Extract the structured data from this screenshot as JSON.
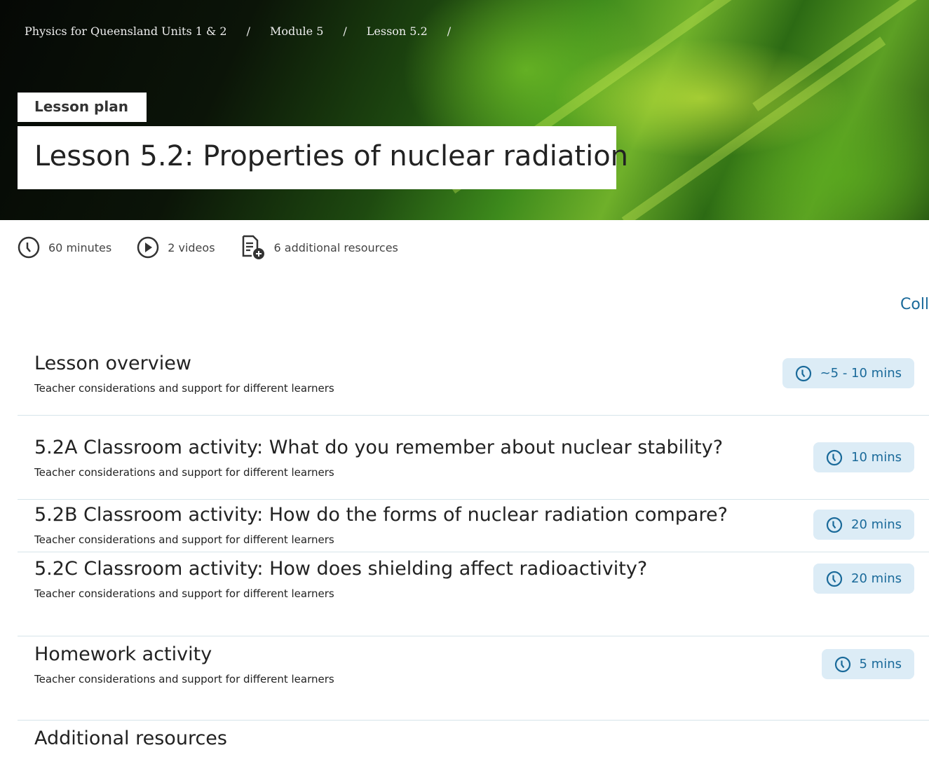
{
  "breadcrumb": [
    "Physics for Queensland Units 1 & 2",
    "/",
    "Module 5",
    "/",
    "Lesson 5.2",
    "/"
  ],
  "tag": "Lesson plan",
  "title": "Lesson 5.2: Properties of nuclear radiation",
  "meta": {
    "duration": "60 minutes",
    "videos": "2 videos",
    "resources": "6 additional resources"
  },
  "collapse_label": "Coll",
  "accent": "#1a6a9a",
  "sections": [
    {
      "title": "Lesson overview",
      "subtitle": "Teacher considerations and support for different learners",
      "time": "~5 - 10 mins"
    },
    {
      "title": "5.2A Classroom activity: What do you remember about nuclear stability?",
      "subtitle": "Teacher considerations and support for different learners",
      "time": "10 mins"
    },
    {
      "title": "5.2B Classroom activity: How do the forms of nuclear radiation compare?",
      "subtitle": "Teacher considerations and support for different learners",
      "time": "20 mins"
    },
    {
      "title": "5.2C Classroom activity: How does shielding affect radioactivity?",
      "subtitle": "Teacher considerations and support for different learners",
      "time": "20 mins"
    },
    {
      "title": "Homework activity",
      "subtitle": "Teacher considerations and support for different learners",
      "time": "5 mins"
    },
    {
      "title": "Additional resources"
    }
  ]
}
